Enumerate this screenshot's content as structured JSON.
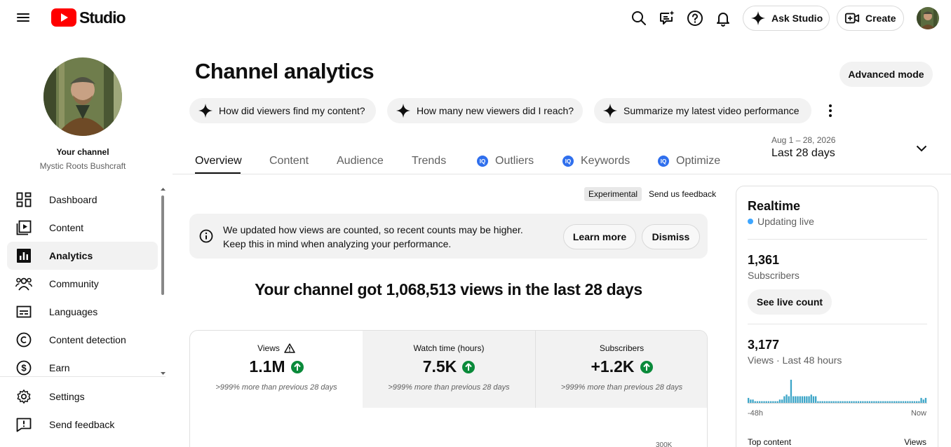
{
  "app": {
    "title": "Studio"
  },
  "header": {
    "ask_studio": "Ask Studio",
    "create": "Create"
  },
  "sidebar": {
    "channel_label": "Your channel",
    "channel_name": "Mystic Roots Bushcraft",
    "items": [
      {
        "label": "Dashboard",
        "icon": "dashboard-icon"
      },
      {
        "label": "Content",
        "icon": "content-icon"
      },
      {
        "label": "Analytics",
        "icon": "analytics-icon",
        "active": true
      },
      {
        "label": "Community",
        "icon": "community-icon"
      },
      {
        "label": "Languages",
        "icon": "subtitles-icon"
      },
      {
        "label": "Content detection",
        "icon": "copyright-icon"
      },
      {
        "label": "Earn",
        "icon": "earn-icon"
      }
    ],
    "footer_items": [
      {
        "label": "Settings",
        "icon": "gear-icon"
      },
      {
        "label": "Send feedback",
        "icon": "feedback-icon"
      }
    ]
  },
  "main": {
    "title": "Channel analytics",
    "advanced_mode": "Advanced mode",
    "prompts": [
      "How did viewers find my content?",
      "How many new viewers did I reach?",
      "Summarize my latest video performance"
    ],
    "tabs": [
      {
        "label": "Overview",
        "active": true
      },
      {
        "label": "Content"
      },
      {
        "label": "Audience"
      },
      {
        "label": "Trends"
      },
      {
        "label": "Outliers",
        "badge": "IQ"
      },
      {
        "label": "Keywords",
        "badge": "IQ"
      },
      {
        "label": "Optimize",
        "badge": "IQ"
      }
    ],
    "date_range": {
      "dates": "Aug 1 – 28, 2026",
      "label": "Last 28 days"
    },
    "experimental": "Experimental",
    "send_feedback": "Send us feedback",
    "notice": {
      "line1": "We updated how views are counted, so recent counts may be higher.",
      "line2": "Keep this in mind when analyzing your performance.",
      "learn_more": "Learn more",
      "dismiss": "Dismiss"
    },
    "headline": "Your channel got 1,068,513 views in the last 28 days",
    "metrics": [
      {
        "label": "Views",
        "value": "1.1M",
        "sub": ">999% more than previous 28 days",
        "warning": true
      },
      {
        "label": "Watch time (hours)",
        "value": "7.5K",
        "sub": ">999% more than previous 28 days"
      },
      {
        "label": "Subscribers",
        "value": "+1.2K",
        "sub": ">999% more than previous 28 days"
      }
    ],
    "chart_partial_tick": "300K"
  },
  "realtime": {
    "title": "Realtime",
    "status": "Updating live",
    "subscribers_value": "1,361",
    "subscribers_label": "Subscribers",
    "see_live_count": "See live count",
    "views_value": "3,177",
    "views_label": "Views · Last 48 hours",
    "axis_start": "-48h",
    "axis_end": "Now",
    "top_content": "Top content",
    "views_col": "Views",
    "bars": [
      3,
      2,
      2,
      1,
      1,
      1,
      1,
      1,
      1,
      1,
      1,
      1,
      1,
      1,
      2,
      2,
      4,
      5,
      4,
      14,
      4,
      4,
      4,
      4,
      4,
      4,
      4,
      4,
      5,
      4,
      4,
      1,
      1,
      1,
      1,
      1,
      1,
      1,
      1,
      1,
      1,
      1,
      1,
      1,
      1,
      1,
      1,
      1,
      1,
      1,
      1,
      1,
      1,
      1,
      1,
      1,
      1,
      1,
      1,
      1,
      1,
      1,
      1,
      1,
      1,
      1,
      1,
      1,
      1,
      1,
      1,
      1,
      1,
      1,
      1,
      1,
      1,
      3,
      2,
      3
    ]
  },
  "colors": {
    "accent_red": "#ff0000",
    "active_tab": "#0f0f0f",
    "up_green": "#0a8a3a",
    "live_blue": "#3ea6ff",
    "iq_blue": "#2f6fed"
  }
}
